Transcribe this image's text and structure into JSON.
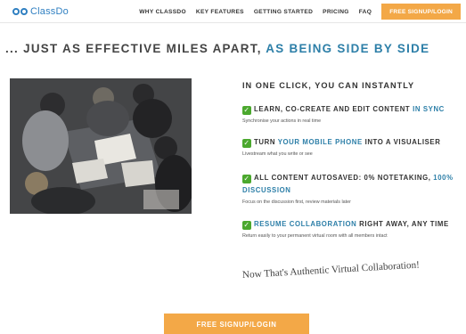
{
  "logo": {
    "text": "ClassDo",
    "icon": "double-circle-logo-icon"
  },
  "nav": {
    "items": [
      "WHY CLASSDO",
      "KEY FEATURES",
      "GETTING STARTED",
      "PRICING",
      "FAQ"
    ],
    "cta": "FREE SIGNUP/LOGIN"
  },
  "headline": {
    "prefix": "... JUST AS EFFECTIVE MILES APART, ",
    "accent": "AS BEING SIDE BY SIDE"
  },
  "section_title": "IN ONE CLICK, YOU CAN INSTANTLY",
  "features": [
    {
      "parts": [
        "LEARN, CO-CREATE AND EDIT CONTENT ",
        "IN SYNC"
      ],
      "desc": "Synchronise your actions in real time"
    },
    {
      "parts": [
        "TURN ",
        "YOUR MOBILE PHONE",
        " INTO A VISUALISER"
      ],
      "desc": "Livestream what you write or see"
    },
    {
      "parts": [
        "ALL CONTENT AUTOSAVED: 0% NOTETAKING, ",
        "100% DISCUSSION"
      ],
      "desc": "Focus on the discussion first, review materials later"
    },
    {
      "parts": [
        "RESUME COLLABORATION",
        " RIGHT AWAY, ANY TIME"
      ],
      "desc": "Return easily to your permanent virtual room with all members intact"
    }
  ],
  "tagline": "Now That's Authentic Virtual Collaboration!",
  "cta_bottom": "FREE SIGNUP/LOGIN",
  "colors": {
    "accent_blue": "#2d7fa8",
    "cta_orange": "#f3a847",
    "check_green": "#4ba82e",
    "logo_blue": "#2f7fc1"
  },
  "icons": {
    "feature_check": "green-checkmark-icon"
  }
}
